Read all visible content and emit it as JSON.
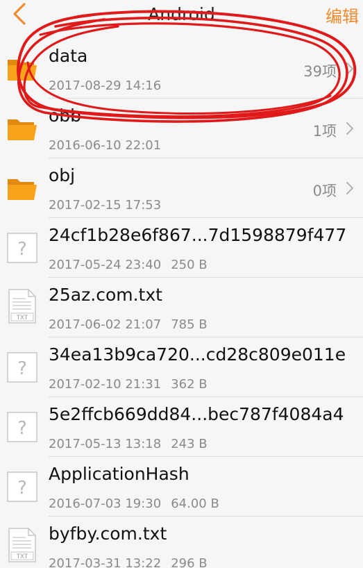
{
  "header": {
    "title": "Android",
    "edit_label": "编辑"
  },
  "files": [
    {
      "name": "data",
      "date": "2017-08-29 14:16",
      "count": "39项",
      "type": "folder"
    },
    {
      "name": "obb",
      "date": "2016-06-10 22:01",
      "count": "1项",
      "type": "folder"
    },
    {
      "name": "obj",
      "date": "2017-02-15 17:53",
      "count": "0项",
      "type": "folder"
    },
    {
      "name": "24cf1b28e6f867...7d1598879f477",
      "date": "2017-05-24 23:40",
      "size": "250 B",
      "type": "unknown"
    },
    {
      "name": "25az.com.txt",
      "date": "2017-06-02 21:07",
      "size": "785 B",
      "type": "txt"
    },
    {
      "name": "34ea13b9ca720...cd28c809e011e",
      "date": "2017-02-10 21:31",
      "size": "362 B",
      "type": "unknown"
    },
    {
      "name": "5e2ffcb669dd84...bec787f4084a4",
      "date": "2017-05-13 13:18",
      "size": "243 B",
      "type": "unknown"
    },
    {
      "name": "ApplicationHash",
      "date": "2016-07-03 19:30",
      "size": "64.00 B",
      "type": "unknown"
    },
    {
      "name": "byfby.com.txt",
      "date": "2017-03-31 13:22",
      "size": "296 B",
      "type": "txt"
    }
  ],
  "icons": {
    "folder": "folder-icon",
    "unknown": "unknown-file-icon",
    "txt": "txt-file-icon"
  },
  "txt_icon_label": "TXT",
  "unknown_icon_glyph": "?",
  "colors": {
    "accent": "#f28a2e",
    "folder": "#f9a21b",
    "annotation": "#e01a1a"
  }
}
